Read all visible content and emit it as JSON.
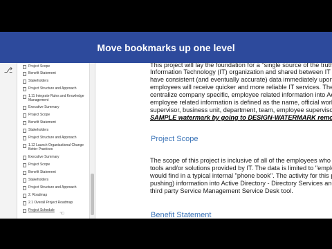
{
  "banner": {
    "title": "Move bookmarks up one level"
  },
  "toolstrip": {
    "icon": "bookmark-cursor-icon"
  },
  "bookmarks": [
    {
      "label": "Project Scope"
    },
    {
      "label": "Benefit Statement"
    },
    {
      "label": "Stakeholders"
    },
    {
      "label": "Project Structure and Approach"
    },
    {
      "label": "1.11 Integrate Rules and Knowledge Management"
    },
    {
      "label": "Executive Summary"
    },
    {
      "label": "Project Scope"
    },
    {
      "label": "Benefit Statement"
    },
    {
      "label": "Stakeholders"
    },
    {
      "label": "Project Structure and Approach"
    },
    {
      "label": "1.12 Launch Organizational Change Better Practices"
    },
    {
      "label": "Executive Summary"
    },
    {
      "label": "Project Scope"
    },
    {
      "label": "Benefit Statement"
    },
    {
      "label": "Stakeholders"
    },
    {
      "label": "Project Structure and Approach"
    },
    {
      "label": "2. Roadmap"
    },
    {
      "label": "2.1 Overall Project Roadmap"
    },
    {
      "label": "Project Schedule"
    }
  ],
  "document": {
    "intro_lines": [
      "This project will lay the foundation for a \"single source of the truth",
      "Information Technology (IT) organization and shared between IT tools",
      "have consistent (and eventually accurate) data immediately upon cont",
      "employees will receive quicker and more reliable IT services.  The scop",
      "centralize company specific, employee related information into Active",
      "employee related information is defined as the name, official work add",
      "supervisor, business unit, department, team, employee supervisor an"
    ],
    "watermark_text": "SAMPLE watermark by going to DESIGN-WATERMARK remove wat",
    "scope_heading": "Project Scope",
    "scope_lines": [
      "The scope of this project is inclusive of all of the employees who deliv",
      "tools and/or solutions provided by IT.  The data is limited to \"employ",
      "would find in a typical internal \"phone book\".  The activity for this p",
      "pushing) information into Active Directory - Directory Services and ex",
      "third party Service Management Service Desk tool."
    ],
    "benefit_heading": "Benefit Statement"
  }
}
